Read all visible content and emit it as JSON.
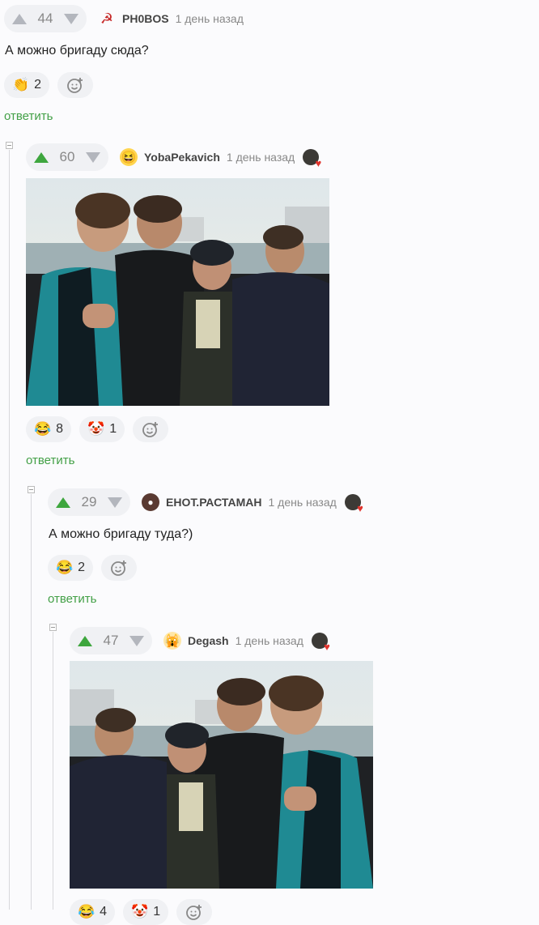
{
  "comments": [
    {
      "rating": "44",
      "nick": "PH0BOS",
      "time": "1 день назад",
      "text": "А можно бригаду сюда?",
      "reactions": [
        {
          "icon": "clap-emoji",
          "count": "2"
        }
      ],
      "reply": "ответить",
      "avatar_icon": "hammer-sickle-icon"
    },
    {
      "rating": "60",
      "nick": "YobaPekavich",
      "time": "1 день назад",
      "reactions": [
        {
          "icon": "laughing-emoji",
          "count": "8"
        },
        {
          "icon": "clown-emoji",
          "count": "1"
        }
      ],
      "reply": "ответить",
      "avatar_icon": "smile-avatar",
      "image": "group-photo"
    },
    {
      "rating": "29",
      "nick": "ЕНОТ.РАСТАМАН",
      "time": "1 день назад",
      "text": "А можно бригаду туда?)",
      "reactions": [
        {
          "icon": "laughing-emoji",
          "count": "2"
        }
      ],
      "reply": "ответить",
      "avatar_icon": "raccoon-avatar"
    },
    {
      "rating": "47",
      "nick": "Degash",
      "time": "1 день назад",
      "reactions": [
        {
          "icon": "laughing-emoji",
          "count": "4"
        },
        {
          "icon": "clown-emoji",
          "count": "1"
        }
      ],
      "avatar_icon": "cat-avatar",
      "image": "group-photo-mirrored"
    }
  ],
  "colors": {
    "accent_green": "#43a047",
    "vote_up_green": "#3ea63e"
  }
}
